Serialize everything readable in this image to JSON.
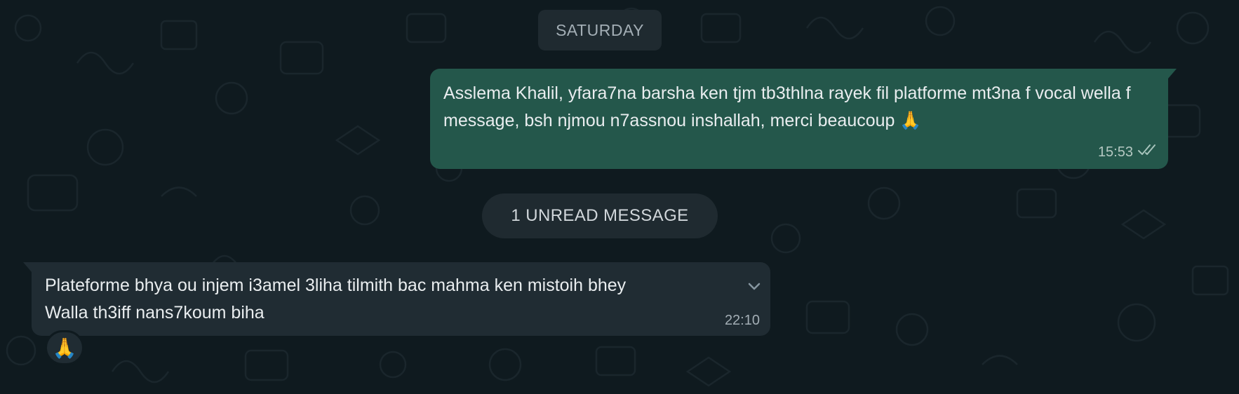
{
  "date_divider": "SATURDAY",
  "outgoing_message": {
    "text": "Asslema Khalil, yfara7na barsha ken tjm tb3thlna rayek fil platforme mt3na f vocal wella f message, bsh njmou n7assnou inshallah, merci beaucoup 🙏",
    "time": "15:53",
    "status_icon": "double-check-icon"
  },
  "unread_divider": "1 UNREAD MESSAGE",
  "incoming_message": {
    "line1": "Plateforme bhya ou injem i3amel 3liha tilmith bac mahma ken mistoih bhey",
    "line2": "Walla th3iff nans7koum biha",
    "time": "22:10",
    "menu_icon": "chevron-down-icon"
  },
  "reaction": {
    "emoji": "🙏"
  },
  "colors": {
    "background": "#0b141a",
    "outgoing_bubble": "#24574b",
    "incoming_bubble": "#202c33",
    "pill": "#1f2a30"
  }
}
